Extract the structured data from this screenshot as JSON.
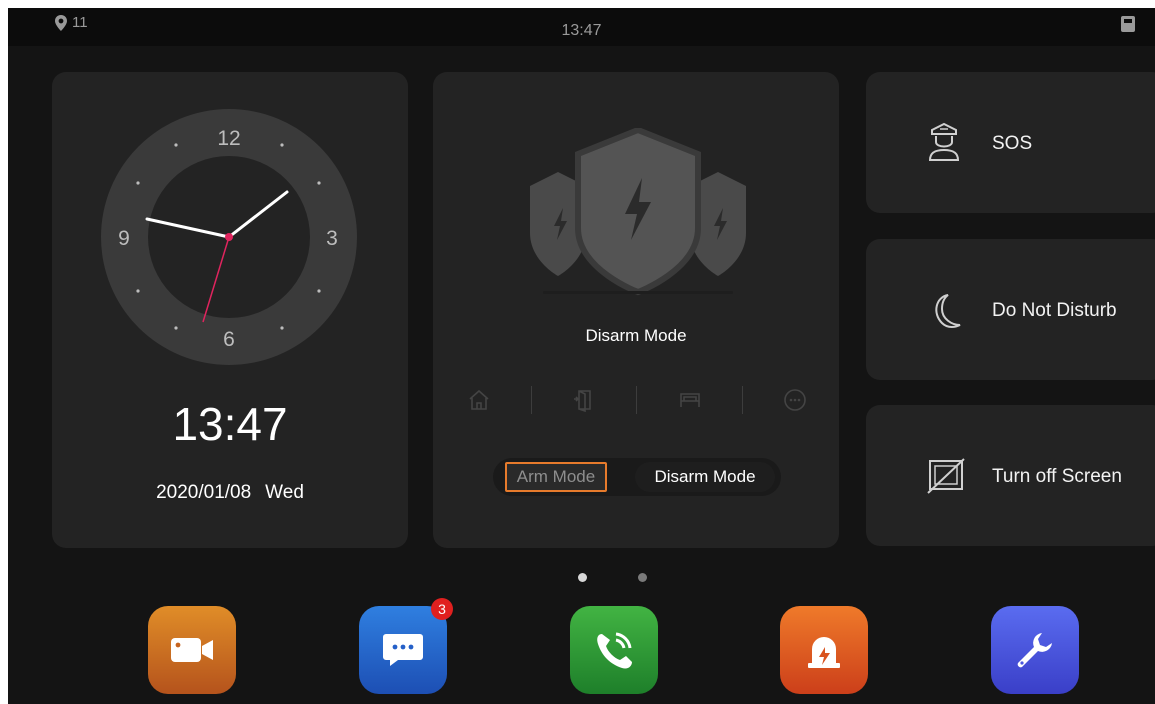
{
  "status_bar": {
    "location_count": "11",
    "time": "13:47"
  },
  "clock": {
    "numerals": {
      "twelve": "12",
      "three": "3",
      "six": "6",
      "nine": "9"
    },
    "digital_time": "13:47",
    "date": "2020/01/08",
    "weekday": "Wed"
  },
  "security": {
    "mode_title": "Disarm Mode",
    "mode_icons": [
      "home-icon",
      "door-icon",
      "bed-icon",
      "more-icon"
    ],
    "arm_label": "Arm Mode",
    "disarm_label": "Disarm Mode"
  },
  "quick_actions": {
    "sos": "SOS",
    "dnd": "Do Not Disturb",
    "screen_off": "Turn off Screen"
  },
  "pagination": {
    "pages": 2,
    "current": 1
  },
  "dock": {
    "apps": [
      "video-camera-icon",
      "messages-icon",
      "call-icon",
      "alarm-icon",
      "settings-icon"
    ],
    "message_badge": "3"
  },
  "colors": {
    "background": "#141414",
    "card": "#232323",
    "highlight": "#e77b2c",
    "clock_second_hand": "#e0245e"
  }
}
